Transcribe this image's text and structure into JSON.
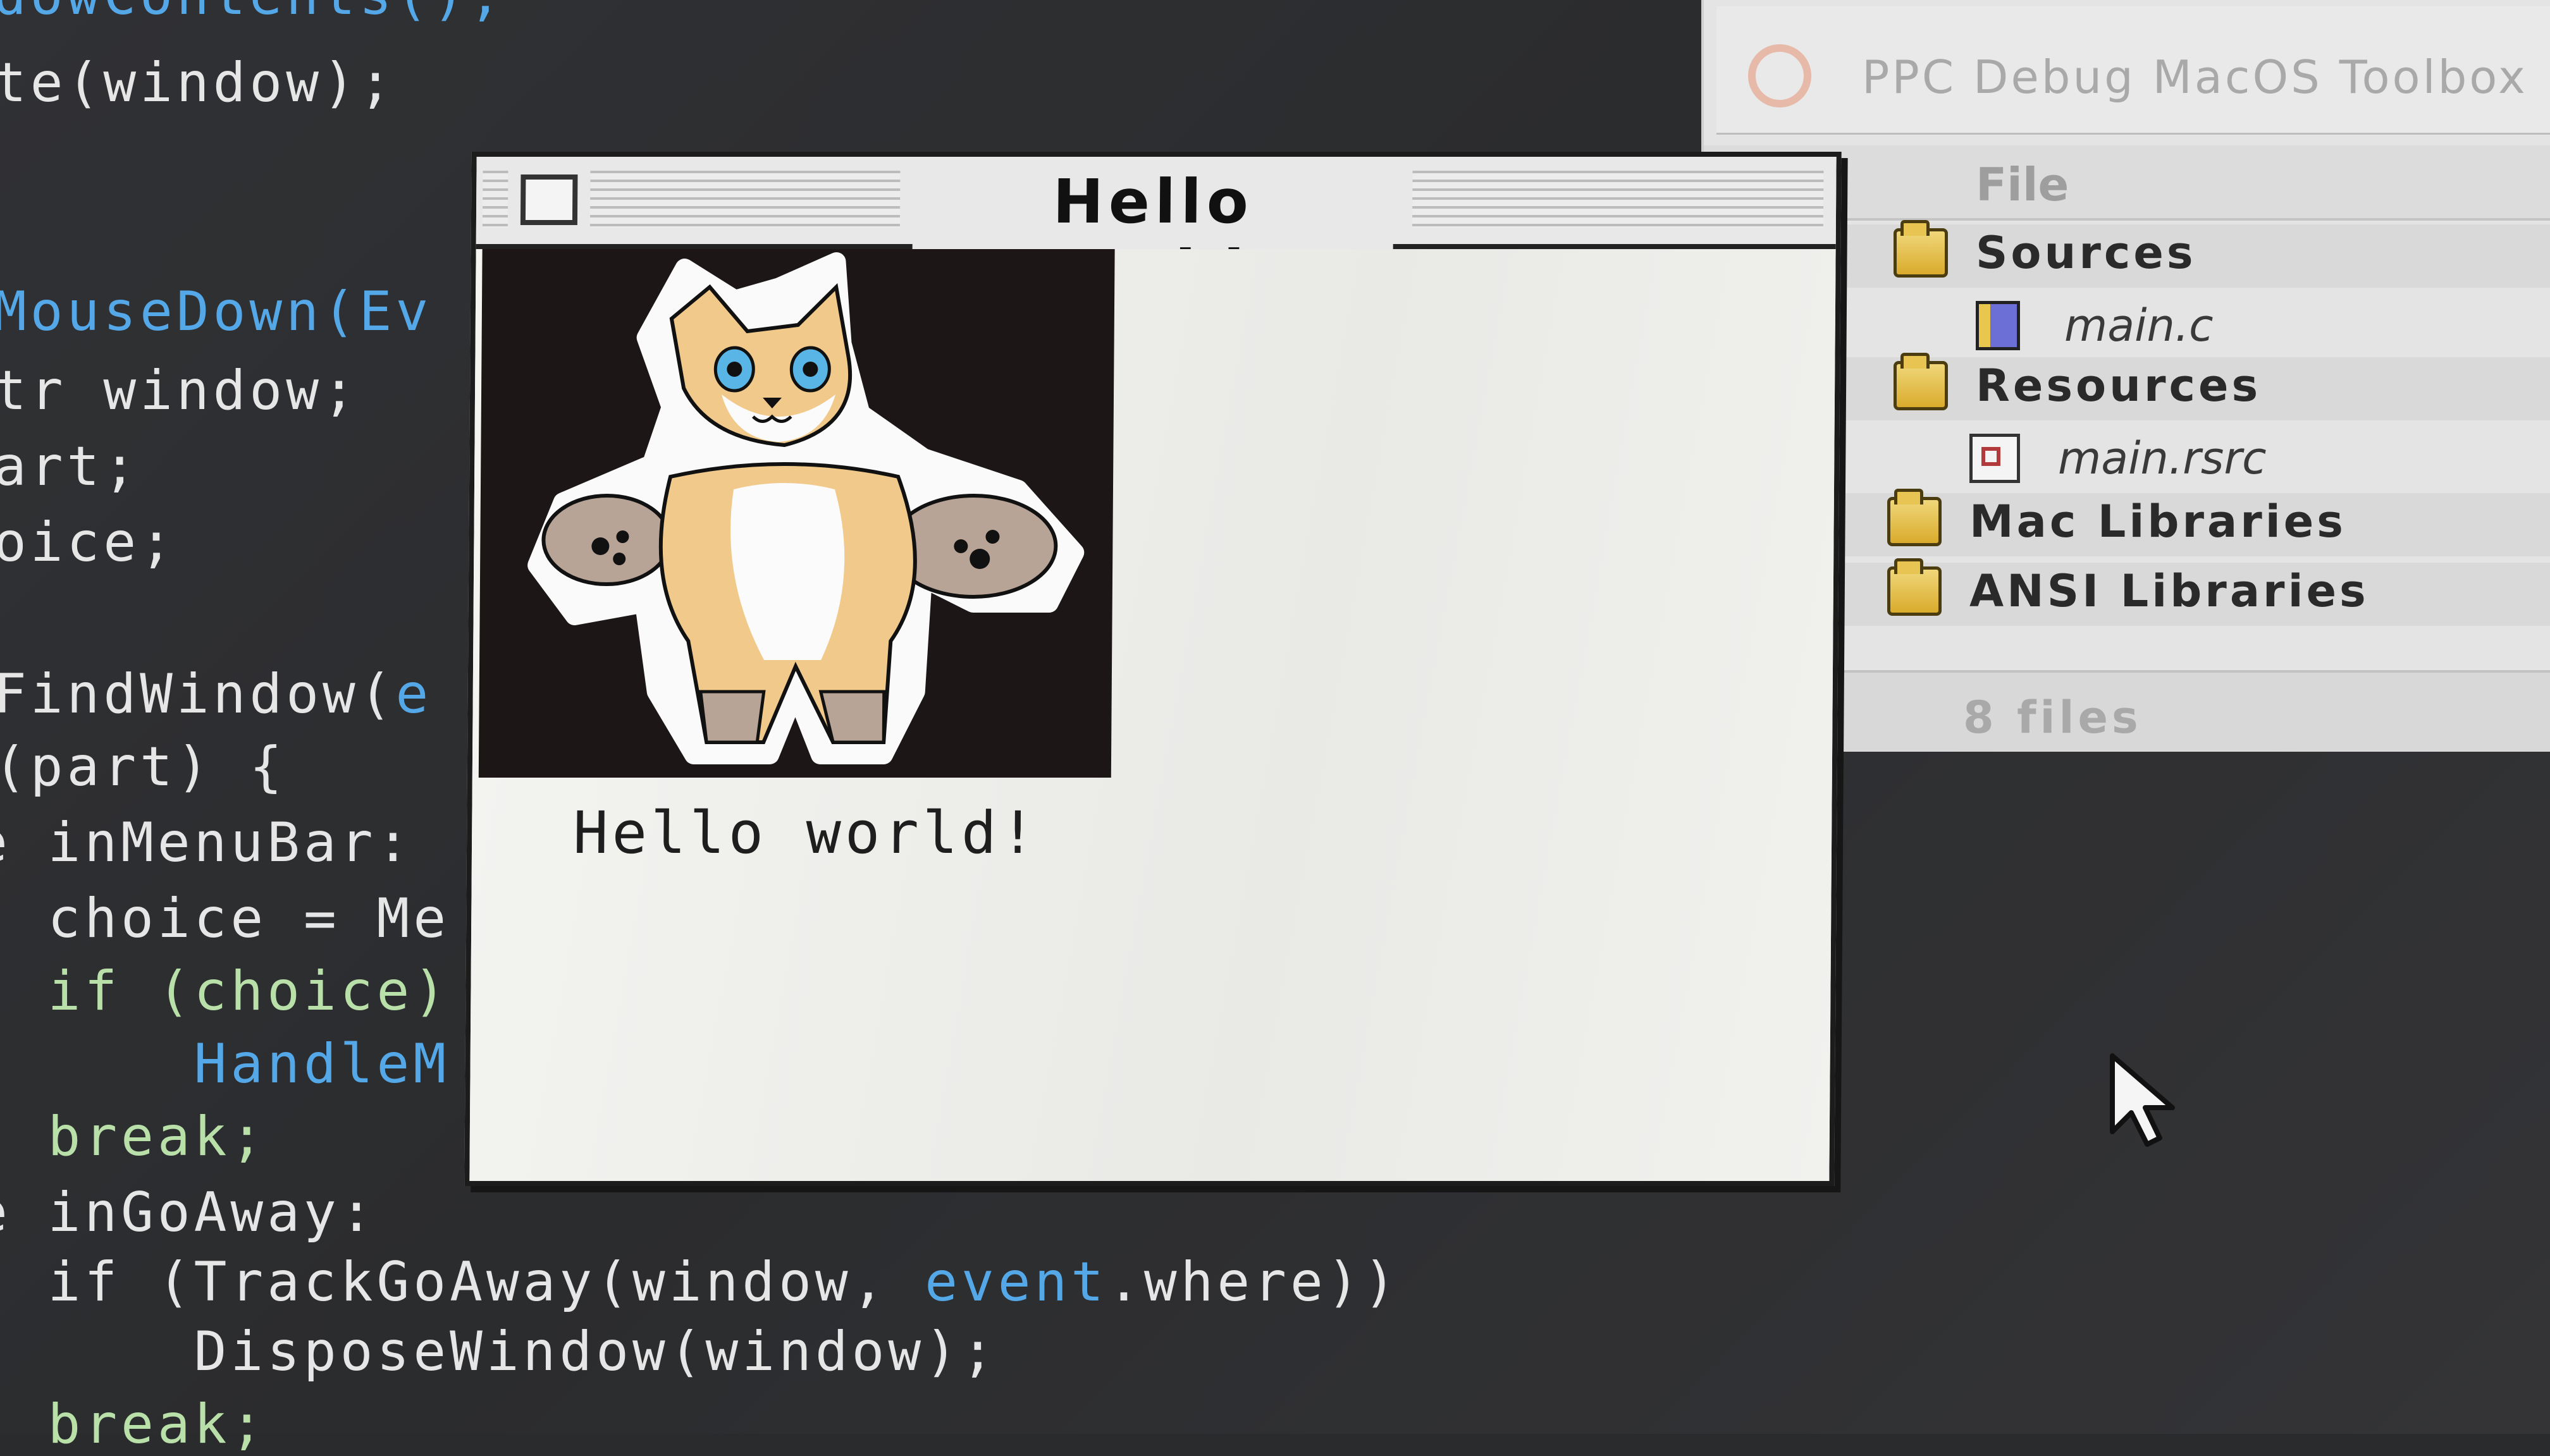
{
  "code_editor": {
    "lines": [
      {
        "id": "l0",
        "parts": [
          {
            "t": "dowContents();",
            "c": "blue"
          }
        ]
      },
      {
        "id": "l1",
        "parts": [
          {
            "t": "te(window);",
            "c": "plain"
          }
        ]
      },
      {
        "id": "l2",
        "parts": [
          {
            "t": "MouseDown(Ev",
            "c": "blue"
          }
        ]
      },
      {
        "id": "l3",
        "parts": [
          {
            "t": "tr window;",
            "c": "plain"
          }
        ]
      },
      {
        "id": "l4",
        "parts": [
          {
            "t": "art;",
            "c": "plain"
          }
        ]
      },
      {
        "id": "l5",
        "parts": [
          {
            "t": "oice;",
            "c": "plain"
          }
        ]
      },
      {
        "id": "l6",
        "parts": [
          {
            "t": "FindWindow(",
            "c": "plain"
          },
          {
            "t": "e",
            "c": "blue"
          }
        ]
      },
      {
        "id": "l7",
        "parts": [
          {
            "t": "(part) {",
            "c": "plain"
          }
        ]
      },
      {
        "id": "l8",
        "parts": [
          {
            "t": "e inMenuBar:",
            "c": "plain"
          }
        ]
      },
      {
        "id": "l9",
        "parts": [
          {
            "t": "  choice = Me",
            "c": "plain"
          }
        ]
      },
      {
        "id": "l10",
        "parts": [
          {
            "t": "  if (choice)",
            "c": "plain"
          }
        ]
      },
      {
        "id": "l11",
        "parts": [
          {
            "t": "      HandleM",
            "c": "blue"
          }
        ]
      },
      {
        "id": "l12",
        "parts": [
          {
            "t": "  break;",
            "c": "green"
          }
        ]
      },
      {
        "id": "l13",
        "parts": [
          {
            "t": "e inGoAway:",
            "c": "plain"
          }
        ]
      },
      {
        "id": "l14",
        "parts": [
          {
            "t": "  if (TrackGoAway(window, ",
            "c": "plain"
          },
          {
            "t": "event",
            "c": "blue"
          },
          {
            "t": ".where))",
            "c": "plain"
          }
        ]
      },
      {
        "id": "l15",
        "parts": [
          {
            "t": "      DisposeWindow(window);",
            "c": "plain"
          }
        ]
      },
      {
        "id": "l16",
        "parts": [
          {
            "t": "  break;",
            "c": "green"
          }
        ]
      }
    ]
  },
  "project_window": {
    "title": "PPC Debug MacOS Toolbox",
    "column_header": "File",
    "rows": [
      {
        "label": "Sources",
        "kind": "group",
        "icon": "folder-icon"
      },
      {
        "label": "main.c",
        "kind": "file",
        "icon": "source-file-icon"
      },
      {
        "label": "Resources",
        "kind": "group",
        "icon": "folder-icon"
      },
      {
        "label": "main.rsrc",
        "kind": "file",
        "icon": "resource-file-icon"
      },
      {
        "label": "Mac Libraries",
        "kind": "group",
        "icon": "folder-icon"
      },
      {
        "label": "ANSI Libraries",
        "kind": "group",
        "icon": "folder-icon"
      }
    ],
    "footer": "8 files"
  },
  "hello_window": {
    "title": "Hello World!",
    "body_text": "Hello world!",
    "picture": "fox-character-picture"
  },
  "colors": {
    "code_plain": "#e6e6e6",
    "code_blue": "#55a8e8",
    "code_green": "#b8e0a8",
    "editor_bg": "#2b2c2e"
  }
}
